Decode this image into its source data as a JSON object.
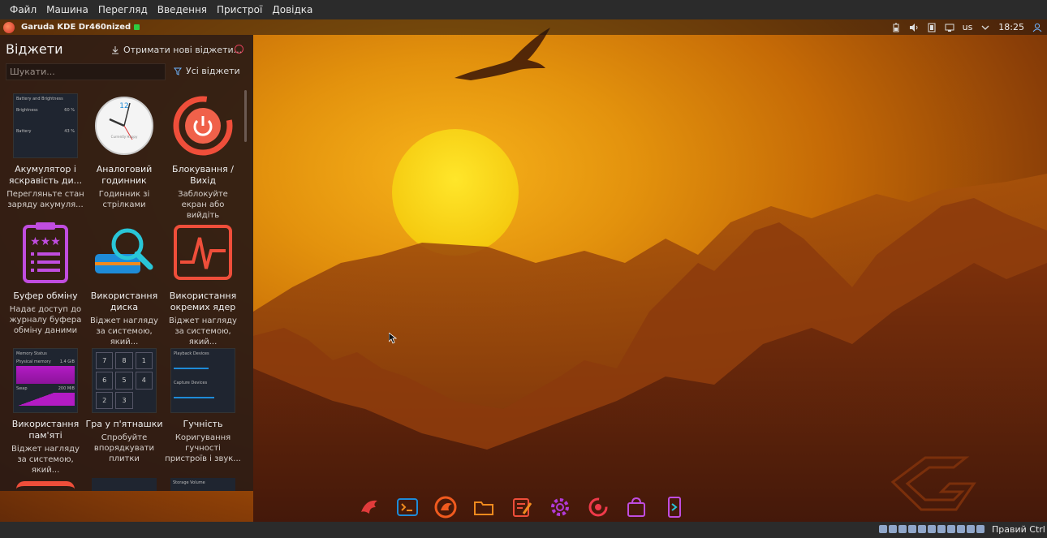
{
  "vbox_menu": [
    "Файл",
    "Машина",
    "Перегляд",
    "Введення",
    "Пристрої",
    "Довідка"
  ],
  "top_panel": {
    "window_title": "Garuda KDE Dr460nized",
    "keyboard_layout": "us",
    "clock": "18:25"
  },
  "widget_panel": {
    "title": "Віджети",
    "get_new_label": "Отримати нові віджети...",
    "search_placeholder": "Шукати...",
    "filter_label": "Усі віджети",
    "widgets": [
      {
        "name": "Акумулятор і яскравість ди...",
        "desc": "Перегляньте стан заряду акумуля...",
        "icon": "battery-brightness-thumbnail"
      },
      {
        "name": "Аналоговий годинник",
        "desc": "Годинник зі стрілками",
        "icon": "analog-clock-icon"
      },
      {
        "name": "Блокування / Вихід",
        "desc": "Заблокуйте екран або вийдіть",
        "icon": "power-icon"
      },
      {
        "name": "Буфер обміну",
        "desc": "Надає доступ до журналу буфера обміну даними",
        "icon": "clipboard-icon"
      },
      {
        "name": "Використання диска",
        "desc": "Віджет нагляду за системою, який...",
        "icon": "disk-usage-icon"
      },
      {
        "name": "Використання окремих ядер",
        "desc": "Віджет нагляду за системою, який...",
        "icon": "cpu-core-icon"
      },
      {
        "name": "Використання пам'яті",
        "desc": "Віджет нагляду за системою, який...",
        "icon": "memory-status-thumbnail"
      },
      {
        "name": "Гра у п'ятнашки",
        "desc": "Спробуйте впорядкувати плитки",
        "icon": "fifteen-puzzle-thumbnail"
      },
      {
        "name": "Гучність",
        "desc": "Коригування гучності пристроїв і звук...",
        "icon": "volume-thumbnail"
      }
    ],
    "thumb_text": {
      "battery_title": "Battery and Brightness",
      "brightness": "Brightness",
      "brightness_val": "60 %",
      "battery": "Battery",
      "battery_val": "43 %",
      "clock_label": "Currently Happy",
      "memory_title": "Memory Status",
      "physical": "Physical memory",
      "physical_val": "1.4 GiB",
      "swap": "Swap",
      "swap_val": "200 MiB",
      "playback": "Playback Devices",
      "capture": "Capture Devices",
      "storage_volume": "Storage Volume",
      "puzzle_tiles": [
        "7",
        "8",
        "1",
        "6",
        "5",
        "4",
        "2",
        "3"
      ]
    }
  },
  "dock": [
    "garuda-icon",
    "terminal-icon",
    "browser-icon",
    "folder-icon",
    "text-editor-icon",
    "settings-icon",
    "garuda-gamer-icon",
    "software-store-icon",
    "phone-connect-icon"
  ],
  "vbox_status": {
    "host_key": "Правий Ctrl"
  },
  "colors": {
    "sun": "#f6d11a",
    "panel_bg": "#2a1a14",
    "accent_red": "#ef4e3a",
    "accent_purple": "#c04de0",
    "accent_blue": "#1e8bd8"
  }
}
